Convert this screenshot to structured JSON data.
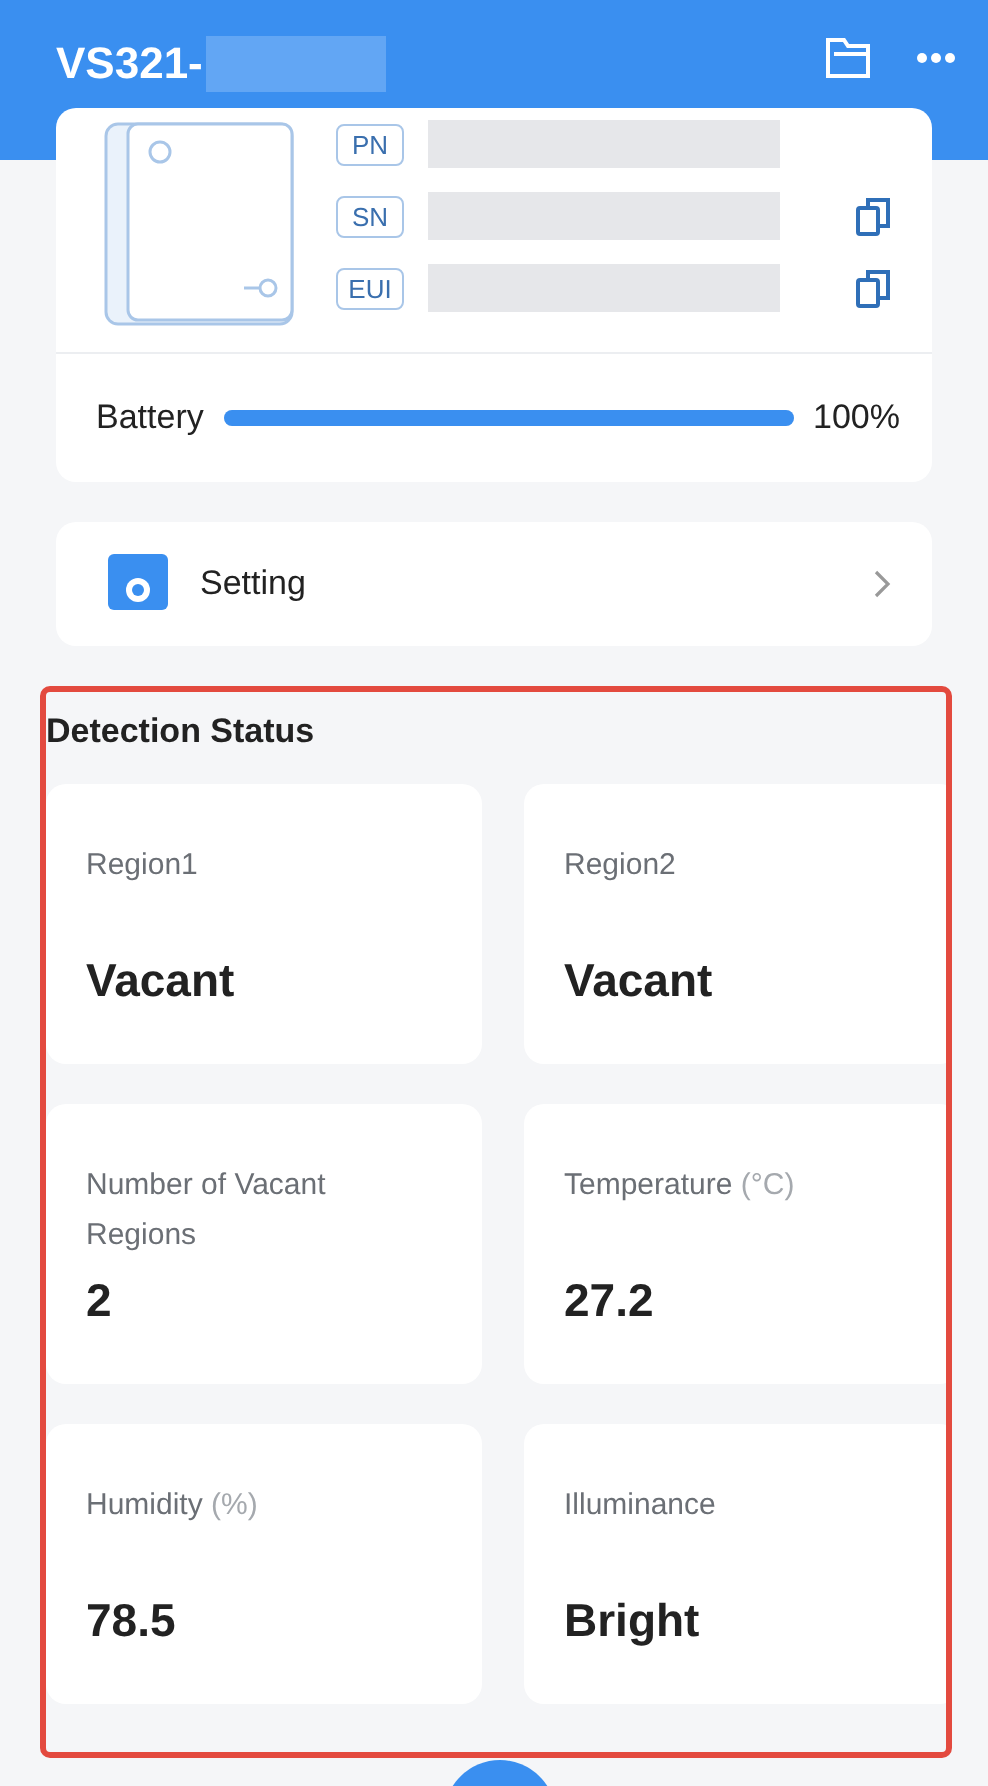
{
  "header": {
    "title": "VS321-"
  },
  "device": {
    "tags": [
      {
        "label": "PN",
        "copyable": false
      },
      {
        "label": "SN",
        "copyable": true
      },
      {
        "label": "EUI",
        "copyable": true
      }
    ]
  },
  "battery": {
    "label": "Battery",
    "level": 1.0,
    "reading": "100%"
  },
  "setting": {
    "label": "Setting"
  },
  "detection": {
    "title": "Detection Status",
    "tiles": [
      {
        "label": "Region1",
        "value": "Vacant"
      },
      {
        "label": "Region2",
        "value": "Vacant"
      },
      {
        "label": "Number of Vacant Regions",
        "value": "2"
      },
      {
        "label": "Temperature",
        "unit": "(°C)",
        "value": "27.2"
      },
      {
        "label": "Humidity",
        "unit": "(%)",
        "value": "78.5"
      },
      {
        "label": "Illuminance",
        "value": "Bright"
      }
    ]
  }
}
